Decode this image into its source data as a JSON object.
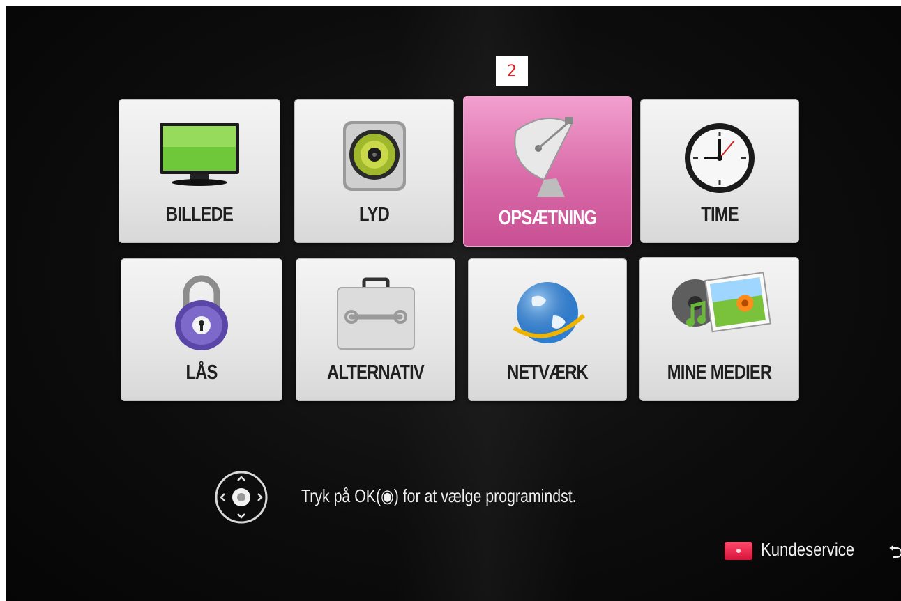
{
  "marker": "2",
  "menu": {
    "tiles": [
      {
        "label": "BILLEDE",
        "icon": "tv-icon"
      },
      {
        "label": "LYD",
        "icon": "speaker-icon"
      },
      {
        "label": "OPSÆTNING",
        "icon": "satellite-dish-icon",
        "selected": true
      },
      {
        "label": "TIME",
        "icon": "clock-icon"
      },
      {
        "label": "LÅS",
        "icon": "padlock-icon"
      },
      {
        "label": "ALTERNATIV",
        "icon": "toolbox-icon"
      },
      {
        "label": "NETVÆRK",
        "icon": "globe-icon"
      },
      {
        "label": "MINE MEDIER",
        "icon": "media-icon"
      }
    ]
  },
  "footer": {
    "hint": "Tryk på OK(◉) for at vælge programindst.",
    "customer_service": "Kundeservice",
    "back_symbol": "⮌"
  },
  "colors": {
    "selected_tile": "#d96aa8",
    "customer_service_button": "#e0203f"
  }
}
